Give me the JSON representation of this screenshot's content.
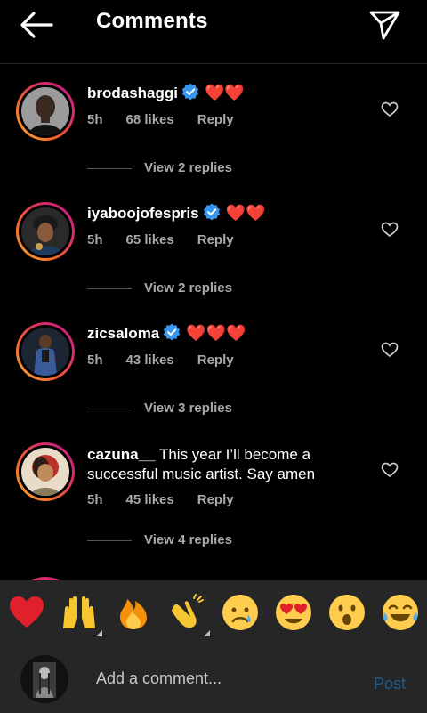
{
  "header": {
    "title": "Comments",
    "back_icon": "arrow-left-icon",
    "share_icon": "paper-plane-icon"
  },
  "comments": [
    {
      "username": "brodashaggi",
      "verified": true,
      "text": "❤️❤️",
      "time": "5h",
      "likes": "68 likes",
      "reply": "Reply",
      "view_replies": "View 2 replies"
    },
    {
      "username": "iyaboojofespris",
      "verified": true,
      "text": "❤️❤️",
      "time": "5h",
      "likes": "65 likes",
      "reply": "Reply",
      "view_replies": "View 2 replies"
    },
    {
      "username": "zicsaloma",
      "verified": true,
      "text": "❤️❤️❤️",
      "time": "5h",
      "likes": "43 likes",
      "reply": "Reply",
      "view_replies": "View 3 replies"
    },
    {
      "username": "cazuna__",
      "verified": false,
      "text": "This year I’ll become a successful music artist. Say amen",
      "time": "5h",
      "likes": "45 likes",
      "reply": "Reply",
      "view_replies": "View 4 replies"
    }
  ],
  "emoji_bar": {
    "items": [
      "red-heart",
      "raising-hands",
      "fire",
      "clapping-hands",
      "crying-face",
      "heart-eyes-face",
      "surprised-face",
      "tears-of-joy-face"
    ]
  },
  "composer": {
    "placeholder": "Add a comment...",
    "post_label": "Post"
  },
  "colors": {
    "background": "#000000",
    "bar_background": "#262626",
    "secondary_text": "#a8a8a8",
    "heart_red": "#e0202a",
    "verified_blue": "#3897f0",
    "post_disabled": "#1f5d8f"
  }
}
